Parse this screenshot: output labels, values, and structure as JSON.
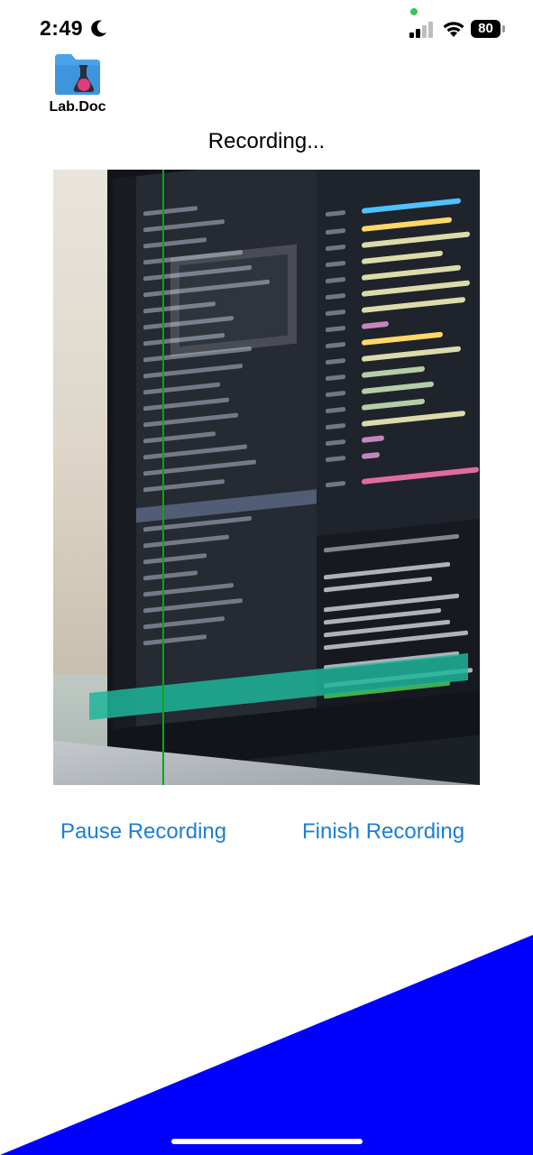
{
  "status_bar": {
    "time": "2:49",
    "battery": "80",
    "icons": [
      "moon-icon",
      "signal-icon",
      "wifi-icon",
      "battery-icon"
    ],
    "privacy_dot_color": "#34c759"
  },
  "app": {
    "name": "Lab.Doc",
    "logo_icon": "folder-flask-icon",
    "accent_color": "#1a7fd6"
  },
  "recording": {
    "title": "Recording...",
    "preview_icon": "camera-preview",
    "scanner_color": "#0aa80a"
  },
  "controls": {
    "pause_label": "Pause Recording",
    "finish_label": "Finish Recording"
  },
  "decoration": {
    "triangle_color": "#0000ff"
  }
}
